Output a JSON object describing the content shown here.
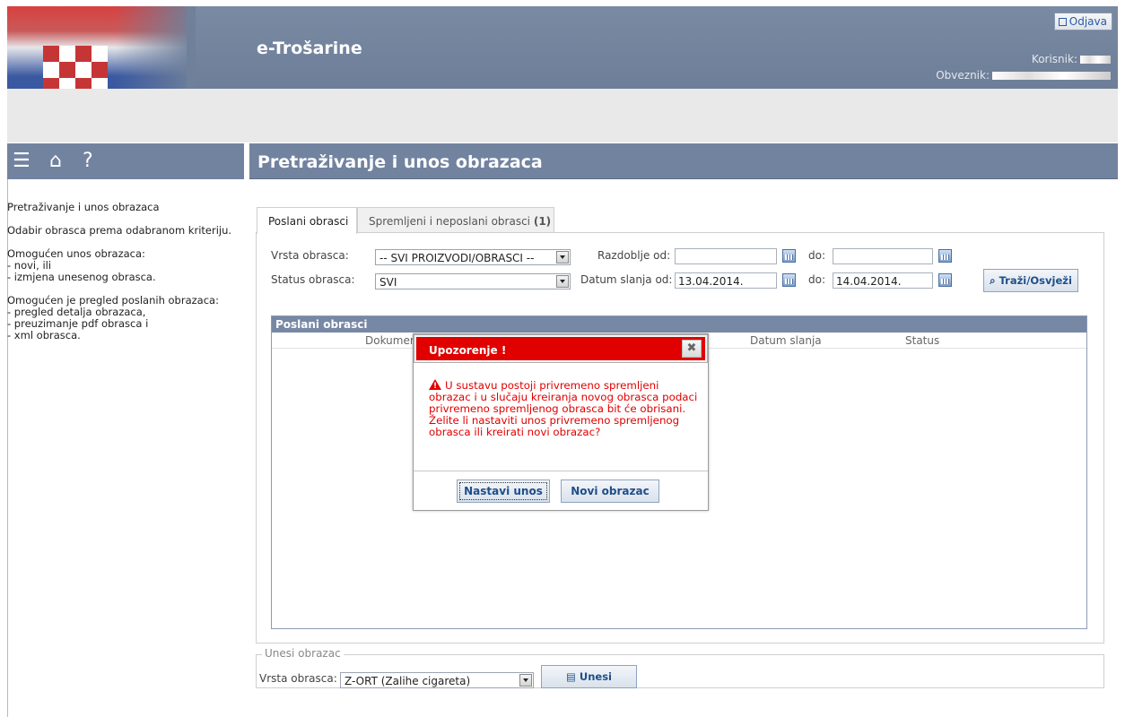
{
  "header": {
    "app_title": "e-Trošarine",
    "logout_label": "Odjava",
    "user_label": "Korisnik:",
    "payer_label": "Obveznik:"
  },
  "left_panel": {
    "icons": [
      "menu-icon",
      "home-icon",
      "help-icon"
    ],
    "help": {
      "p1": "Pretraživanje i unos obrazaca",
      "p2": "Odabir obrasca prema odabranom kriteriju.",
      "p3_title": "Omogućen unos obrazaca:",
      "p3_items": [
        "- novi, ili",
        "- izmjena unesenog obrasca."
      ],
      "p4_title": "Omogućen je pregled poslanih obrazaca:",
      "p4_items": [
        "- pregled detalja obrazaca,",
        "- preuzimanje pdf obrasca i",
        "- xml obrasca."
      ]
    }
  },
  "main": {
    "page_title": "Pretraživanje i unos obrazaca",
    "tabs": [
      {
        "label": "Poslani obrasci",
        "active": true
      },
      {
        "label": "Spremljeni i neposlani obrasci",
        "count": "(1)",
        "active": false
      }
    ],
    "filters": {
      "form_type_label": "Vrsta obrasca:",
      "form_type_value": "-- SVI PROIZVODI/OBRASCI --",
      "period_from_label": "Razdoblje od:",
      "period_from_value": "",
      "period_to_label": "do:",
      "period_to_value": "",
      "status_label": "Status obrasca:",
      "status_value": "SVI",
      "sent_from_label": "Datum slanja od:",
      "sent_from_value": "13.04.2014.",
      "sent_to_label": "do:",
      "sent_to_value": "14.04.2014.",
      "search_button": "Traži/Osvježi"
    },
    "grid": {
      "title": "Poslani obrasci",
      "columns": [
        "Dokumen",
        "Datum slanja",
        "Status"
      ]
    },
    "entry": {
      "legend": "Unesi obrazac",
      "form_type_label": "Vrsta obrasca:",
      "form_type_value": "Z-ORT (Zalihe cigareta)",
      "submit_button": "Unesi"
    }
  },
  "dialog": {
    "title": "Upozorenje !",
    "message": "U sustavu postoji privremeno spremljeni obrazac i u slučaju kreiranja novog obrasca podaci privremeno spremljenog obrasca bit će obrisani. Želite li nastaviti unos privremeno spremljenog obrasca ili kreirati novi obrazac?",
    "continue_button": "Nastavi unos",
    "new_button": "Novi obrazac"
  },
  "colors": {
    "header": "#6d7e98",
    "section_header": "#7283a0",
    "dialog_title": "#e00000",
    "link_blue": "#1f4e8a"
  }
}
